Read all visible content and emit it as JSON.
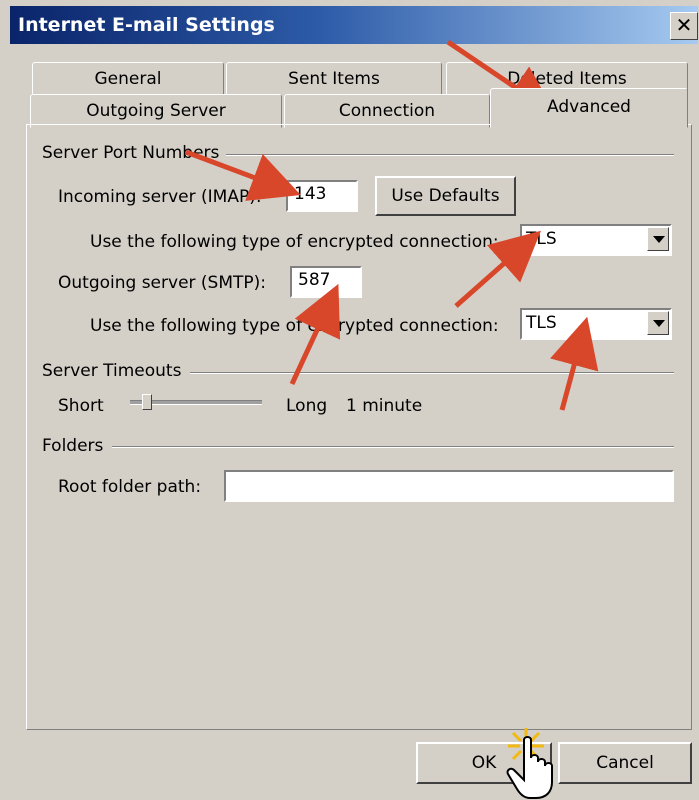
{
  "window": {
    "title": "Internet E-mail Settings",
    "close_glyph": "✕"
  },
  "tabs_row1": [
    {
      "label": "General"
    },
    {
      "label": "Sent Items"
    },
    {
      "label": "Deleted Items"
    }
  ],
  "tabs_row2": [
    {
      "label": "Outgoing Server"
    },
    {
      "label": "Connection"
    },
    {
      "label": "Advanced",
      "active": true
    }
  ],
  "server_ports": {
    "group_label": "Server Port Numbers",
    "incoming_label": "Incoming server (IMAP):",
    "incoming_value": "143",
    "use_defaults_label": "Use Defaults",
    "incoming_enc_label": "Use the following type of encrypted connection:",
    "incoming_enc_value": "TLS",
    "outgoing_label": "Outgoing server (SMTP):",
    "outgoing_value": "587",
    "outgoing_enc_label": "Use the following type of encrypted connection:",
    "outgoing_enc_value": "TLS"
  },
  "timeouts": {
    "group_label": "Server Timeouts",
    "short_label": "Short",
    "long_label": "Long",
    "value_label": "1 minute",
    "slider_level": 0.12
  },
  "folders": {
    "group_label": "Folders",
    "root_label": "Root folder path:",
    "root_value": ""
  },
  "buttons": {
    "ok": "OK",
    "cancel": "Cancel"
  },
  "annotation_color": "#d9472b"
}
